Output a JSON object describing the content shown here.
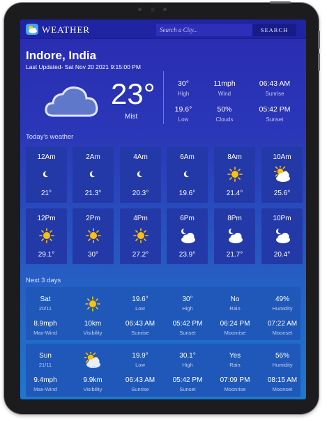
{
  "app": {
    "title": "WEATHER"
  },
  "search": {
    "placeholder": "Search a City...",
    "button_label": "SEARCH"
  },
  "location": {
    "city": "Indore, India",
    "last_updated": "Last Updated- Sat Nov 20 2021 9:15:00 PM"
  },
  "current": {
    "icon": "cloud-icon",
    "temperature": "23°",
    "condition": "Mist",
    "stats": [
      {
        "value": "30°",
        "label": "High"
      },
      {
        "value": "11mph",
        "label": "Wind"
      },
      {
        "value": "06:43 AM",
        "label": "Sunrise"
      },
      {
        "value": "19.6°",
        "label": "Low"
      },
      {
        "value": "50%",
        "label": "Clouds"
      },
      {
        "value": "05:42 PM",
        "label": "Sunset"
      }
    ]
  },
  "today": {
    "heading": "Today's weather",
    "hours": [
      {
        "time": "12Am",
        "icon": "moon-icon",
        "temp": "21°"
      },
      {
        "time": "2Am",
        "icon": "moon-icon",
        "temp": "21.3°"
      },
      {
        "time": "4Am",
        "icon": "moon-icon",
        "temp": "20.3°"
      },
      {
        "time": "6Am",
        "icon": "moon-icon",
        "temp": "19.6°"
      },
      {
        "time": "8Am",
        "icon": "sun-icon",
        "temp": "21.4°"
      },
      {
        "time": "10Am",
        "icon": "sun-cloud-icon",
        "temp": "25.6°"
      },
      {
        "time": "12Pm",
        "icon": "sun-icon",
        "temp": "29.1°"
      },
      {
        "time": "2Pm",
        "icon": "sun-icon",
        "temp": "30°"
      },
      {
        "time": "4Pm",
        "icon": "sun-icon",
        "temp": "27.2°"
      },
      {
        "time": "6Pm",
        "icon": "moon-cloud-icon",
        "temp": "23.9°"
      },
      {
        "time": "8Pm",
        "icon": "moon-cloud-icon",
        "temp": "21.7°"
      },
      {
        "time": "10Pm",
        "icon": "moon-cloud-icon",
        "temp": "20.4°"
      }
    ]
  },
  "next_days": {
    "heading": "Next 3 days",
    "days": [
      {
        "day": "Sat",
        "date": "20/11",
        "icon": "sun-icon",
        "row1": [
          {
            "value": "19.6°",
            "label": "Low"
          },
          {
            "value": "30°",
            "label": "High"
          },
          {
            "value": "No",
            "label": "Rain"
          },
          {
            "value": "49%",
            "label": "Humidity"
          }
        ],
        "row2": [
          {
            "value": "8.9mph",
            "label": "Max-Wind"
          },
          {
            "value": "10km",
            "label": "Visibility"
          },
          {
            "value": "06:43 AM",
            "label": "Sunrise"
          },
          {
            "value": "05:42 PM",
            "label": "Sunset"
          },
          {
            "value": "06:24 PM",
            "label": "Moonrise"
          },
          {
            "value": "07:22 AM",
            "label": "Moonset"
          }
        ]
      },
      {
        "day": "Sun",
        "date": "21/11",
        "icon": "sun-rain-cloud-icon",
        "row1": [
          {
            "value": "19.9°",
            "label": "Low"
          },
          {
            "value": "30.1°",
            "label": "High"
          },
          {
            "value": "Yes",
            "label": "Rain"
          },
          {
            "value": "56%",
            "label": "Humidity"
          }
        ],
        "row2": [
          {
            "value": "9.4mph",
            "label": "Max-Wind"
          },
          {
            "value": "9.9km",
            "label": "Visibility"
          },
          {
            "value": "06:43 AM",
            "label": "Sunrise"
          },
          {
            "value": "05:42 PM",
            "label": "Sunset"
          },
          {
            "value": "07:09 PM",
            "label": "Moonrise"
          },
          {
            "value": "08:15 AM",
            "label": "Moonset"
          }
        ]
      }
    ]
  },
  "colors": {
    "bg_top": "#2a2bb0",
    "bg_bottom": "#1d78cf",
    "card": "#2439a8",
    "day_row": "#1f58b8",
    "sun": "#ffc107",
    "moon": "#ffffff",
    "cloud": "#ffffff"
  }
}
